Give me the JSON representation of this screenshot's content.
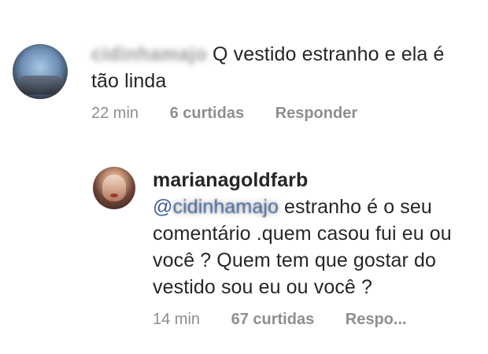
{
  "comments": [
    {
      "username": "cidinhamajo",
      "text": "Q vestido estranho e ela é tão linda",
      "time": "22 min",
      "likes": "6 curtidas",
      "reply_label": "Responder"
    },
    {
      "username": "marianagoldfarb",
      "mention_prefix": "@",
      "mention_user": "cidinhamajo",
      "text": "estranho é o seu comentário .quem casou fui eu ou você ? Quem tem que gostar do vestido sou eu ou você ?",
      "time": "14 min",
      "likes": "67 curtidas",
      "reply_label": "Respo..."
    }
  ],
  "icons": {
    "top_fragment": "dot"
  }
}
